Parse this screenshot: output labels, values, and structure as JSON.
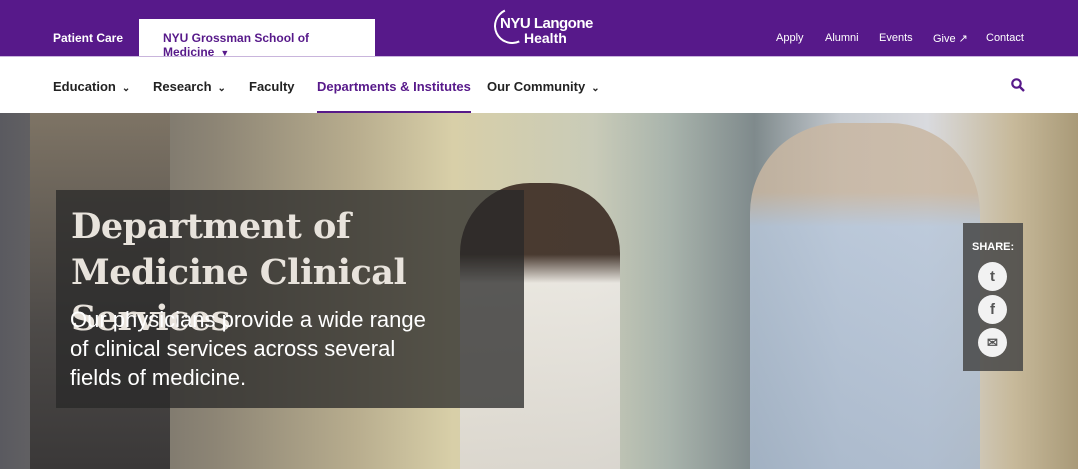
{
  "top": {
    "patient_care": "Patient Care",
    "school": "NYU Grossman School of Medicine",
    "logo_line1": "NYU Langone",
    "logo_line2": "Health",
    "utility": [
      {
        "label": "Apply"
      },
      {
        "label": "Alumni"
      },
      {
        "label": "Events"
      },
      {
        "label": "Give ↗"
      },
      {
        "label": "Contact"
      }
    ]
  },
  "nav": {
    "items": [
      {
        "label": "Education"
      },
      {
        "label": "Research"
      },
      {
        "label": "Faculty"
      },
      {
        "label": "Departments & Institutes"
      },
      {
        "label": "Our Community"
      }
    ]
  },
  "hero": {
    "title": "Department of Medicine Clinical Services",
    "subtitle": "Our physicians provide a wide range of clinical services across several fields of medicine."
  },
  "share": {
    "label": "SHARE:",
    "icons": [
      "twitter-icon",
      "facebook-icon",
      "email-icon"
    ]
  },
  "colors": {
    "brand": "#57198a"
  }
}
